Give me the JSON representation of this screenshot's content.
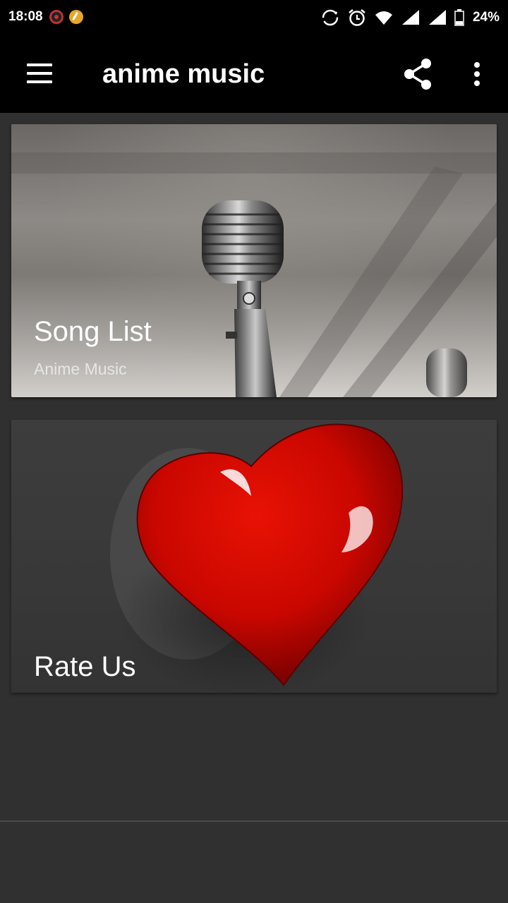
{
  "status_bar": {
    "time": "18:08",
    "battery": "24%",
    "icons": [
      "notification-record-icon",
      "notification-app-icon",
      "sync-icon",
      "alarm-icon",
      "wifi-icon",
      "signal-icon",
      "signal-icon",
      "battery-icon"
    ]
  },
  "app_bar": {
    "title": "anime music",
    "icons": [
      "menu-icon",
      "share-icon",
      "more-vert-icon"
    ]
  },
  "cards": [
    {
      "title": "Song List",
      "subtitle": "Anime Music",
      "image": "microphone-image"
    },
    {
      "title": "Rate Us",
      "image": "heart-image"
    }
  ],
  "colors": {
    "background": "#303030",
    "app_bar": "#000000",
    "heart": "#d40b00"
  }
}
